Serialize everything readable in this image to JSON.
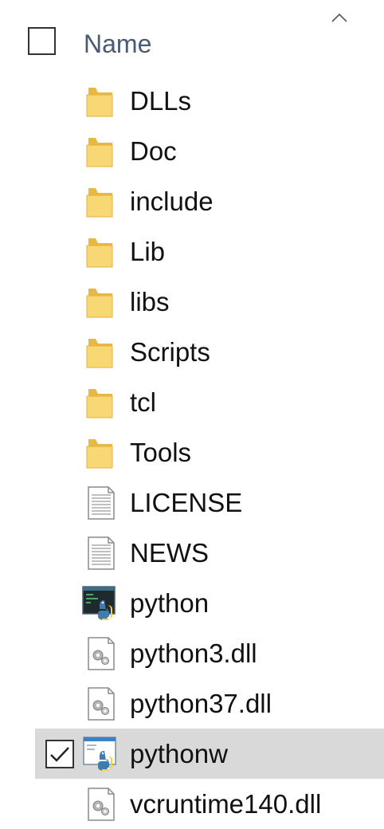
{
  "header": {
    "column_name": "Name",
    "sort_icon": "chevron-up-icon"
  },
  "files": [
    {
      "name": "DLLs",
      "icon": "folder-icon",
      "selected": false
    },
    {
      "name": "Doc",
      "icon": "folder-icon",
      "selected": false
    },
    {
      "name": "include",
      "icon": "folder-icon",
      "selected": false
    },
    {
      "name": "Lib",
      "icon": "folder-icon",
      "selected": false
    },
    {
      "name": "libs",
      "icon": "folder-icon",
      "selected": false
    },
    {
      "name": "Scripts",
      "icon": "folder-icon",
      "selected": false
    },
    {
      "name": "tcl",
      "icon": "folder-icon",
      "selected": false
    },
    {
      "name": "Tools",
      "icon": "folder-icon",
      "selected": false
    },
    {
      "name": "LICENSE",
      "icon": "text-file-icon",
      "selected": false
    },
    {
      "name": "NEWS",
      "icon": "text-file-icon",
      "selected": false
    },
    {
      "name": "python",
      "icon": "python-console-icon",
      "selected": false
    },
    {
      "name": "python3.dll",
      "icon": "dll-file-icon",
      "selected": false
    },
    {
      "name": "python37.dll",
      "icon": "dll-file-icon",
      "selected": false
    },
    {
      "name": "pythonw",
      "icon": "python-window-icon",
      "selected": true
    },
    {
      "name": "vcruntime140.dll",
      "icon": "dll-file-icon",
      "selected": false
    }
  ],
  "colors": {
    "folder": "#f8d775",
    "folder_dark": "#e8b844",
    "selection": "#d9d9d9",
    "header_text": "#4a5a72"
  }
}
